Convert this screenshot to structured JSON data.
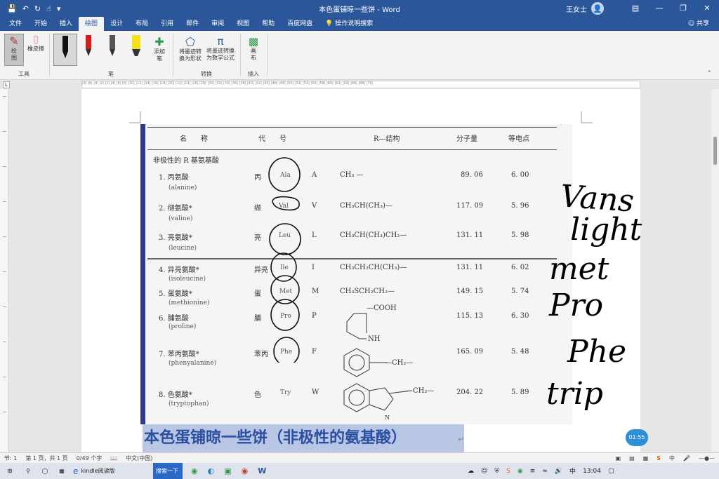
{
  "window": {
    "title": "本色蛋铺晾一些饼 - Word",
    "user_name": "王女士",
    "avatar_glyph": "👤"
  },
  "quick_access": {
    "save_icon": "save-icon",
    "undo_icon": "undo-icon",
    "redo_icon": "redo-icon"
  },
  "tabs": [
    "文件",
    "开始",
    "插入",
    "绘图",
    "设计",
    "布局",
    "引用",
    "邮件",
    "审阅",
    "视图",
    "帮助",
    "百度网盘"
  ],
  "active_tab": "绘图",
  "tell_me": "操作说明搜索",
  "share": "共享",
  "ribbon": {
    "draw_label": "绘\n图",
    "eraser_label": "橡皮擦",
    "tools_group": "工具",
    "add_pen_label": "添加\n笔",
    "pens_group": "笔",
    "ink_to_shape": "将墨迹转\n换为形状",
    "ink_to_math": "将墨迹转换\n为数学公式",
    "convert_group": "转换",
    "canvas_label": "画\n布",
    "insert_group": "插入"
  },
  "ruler_marks": "|8| |6| |4| |2|      |2| |4| |6| |8| |10| |12| |14| |16| |18| |20| |22| |24| |26| |28| |30| |32| |34| |36| |38| |40| |42| |44| |46| |48| |50| |52| |54| |56| |58| |60| |62| |64| |66| |68| |70|",
  "scan": {
    "headers": [
      "名　　称",
      "代　　号",
      "R—结构",
      "分子量",
      "等电点"
    ],
    "section_title": "非极性的 R 基氨基酸",
    "rows": [
      {
        "num": "1. 丙氨酸",
        "en": "(alanine)",
        "cn": "丙",
        "abbr": "Ala",
        "letter": "A",
        "r": "CH₃ —",
        "mw": "89. 06",
        "pi": "6. 00"
      },
      {
        "num": "2. 缬氨酸*",
        "en": "(valine)",
        "cn": "缬",
        "abbr": "Val",
        "letter": "V",
        "r": "CH₃CH(CH₃)—",
        "mw": "117. 09",
        "pi": "5. 96"
      },
      {
        "num": "3. 亮氨酸*",
        "en": "(leucine)",
        "cn": "亮",
        "abbr": "Leu",
        "letter": "L",
        "r": "CH₃CH(CH₃)CH₂—",
        "mw": "131. 11",
        "pi": "5. 98"
      },
      {
        "num": "4. 异亮氨酸*",
        "en": "(isoleucine)",
        "cn": "异亮",
        "abbr": "Ile",
        "letter": "I",
        "r": "CH₃CH₂CH(CH₃)—",
        "mw": "131. 11",
        "pi": "6. 02"
      },
      {
        "num": "5. 蛋氨酸*",
        "en": "(methionine)",
        "cn": "蛋",
        "abbr": "Met",
        "letter": "M",
        "r": "CH₃SCH₂CH₂—",
        "mw": "149. 15",
        "pi": "5. 74"
      },
      {
        "num": "6. 脯氨酸",
        "en": "(proline)",
        "cn": "脯",
        "abbr": "Pro",
        "letter": "P",
        "r": "—COOH",
        "mw": "115. 13",
        "pi": "6. 30"
      },
      {
        "num": "7. 苯丙氨酸*",
        "en": "(phenyalanine)",
        "cn": "苯丙",
        "abbr": "Phe",
        "letter": "F",
        "r": "—CH₂—",
        "mw": "165. 09",
        "pi": "5. 48"
      },
      {
        "num": "8. 色氨酸*",
        "en": "(tryptophan)",
        "cn": "色",
        "abbr": "Try",
        "letter": "W",
        "r": "—CH₂—",
        "mw": "204. 22",
        "pi": "5. 89"
      }
    ],
    "pro_nh": "NH",
    "try_n": "N"
  },
  "handwriting": [
    "Vans",
    "light",
    "met",
    "Pro",
    "Phe",
    "trip"
  ],
  "caption": "本色蛋铺晾一些饼（非极性的氨基酸）",
  "timer": "01:55",
  "status": {
    "section": "节: 1",
    "page": "第 1 页，共 1 页",
    "words": "0/49 个字",
    "lang": "中文(中国)"
  },
  "taskbar": {
    "app_kindle": "kindle阅读版",
    "search_label": "搜索一下",
    "time": "13:04"
  },
  "colors": {
    "word_blue": "#2b579a",
    "caption_bg": "#b9c7e4",
    "caption_text": "#2b4fa0",
    "pen_red": "#d11d1d",
    "pen_yellow": "#f5e11b"
  }
}
